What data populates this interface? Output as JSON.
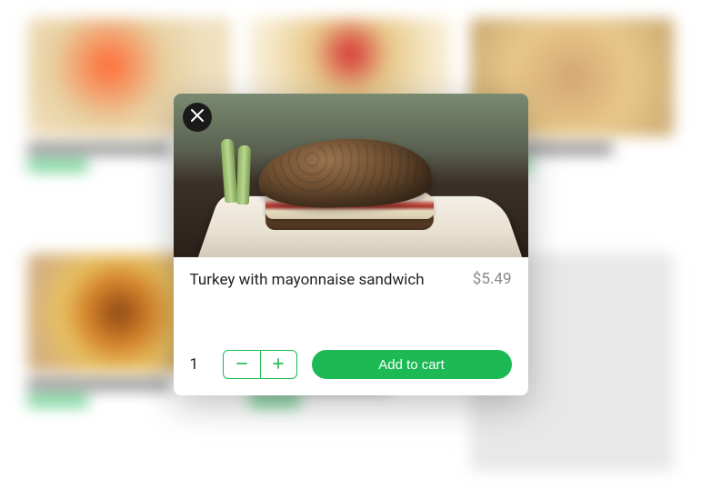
{
  "modal": {
    "product_title": "Turkey with mayonnaise sandwich",
    "price": "$5.49",
    "quantity": "1",
    "add_to_cart_label": "Add to cart"
  },
  "colors": {
    "accent": "#1db954"
  }
}
